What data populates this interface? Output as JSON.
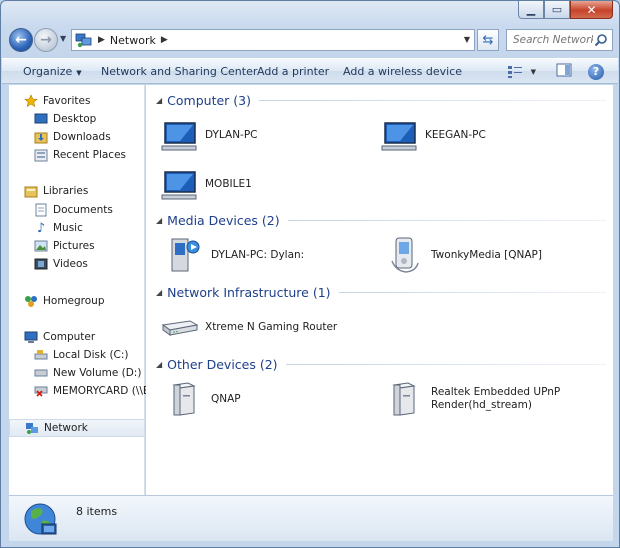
{
  "window": {
    "caption": {
      "minimize": "▁",
      "maximize": "▭",
      "close": "✕"
    }
  },
  "address": {
    "crumb": "Network"
  },
  "search": {
    "placeholder": "Search Network"
  },
  "commands": {
    "organize": "Organize",
    "network_sharing": "Network and Sharing Center",
    "add_printer": "Add a printer",
    "add_wireless": "Add a wireless device"
  },
  "nav": {
    "favorites": "Favorites",
    "desktop": "Desktop",
    "downloads": "Downloads",
    "recent_places": "Recent Places",
    "libraries": "Libraries",
    "documents": "Documents",
    "music": "Music",
    "pictures": "Pictures",
    "videos": "Videos",
    "homegroup": "Homegroup",
    "computer": "Computer",
    "local_disk": "Local Disk (C:)",
    "new_volume": "New Volume (D:)",
    "memorycard": "MEMORYCARD (\\\\E",
    "network": "Network"
  },
  "groups": {
    "computer": "Computer (3)",
    "media": "Media Devices (2)",
    "infra": "Network Infrastructure (1)",
    "other": "Other Devices (2)"
  },
  "items": {
    "dylan_pc": "DYLAN-PC",
    "keegan_pc": "KEEGAN-PC",
    "mobile1": "MOBILE1",
    "dylan_media": "DYLAN-PC: Dylan:",
    "twonky": "TwonkyMedia [QNAP]",
    "router": "Xtreme N Gaming Router",
    "qnap": "QNAP",
    "realtek_line1": "Realtek Embedded UPnP",
    "realtek_line2": "Render(hd_stream)"
  },
  "status": {
    "count": "8 items"
  }
}
